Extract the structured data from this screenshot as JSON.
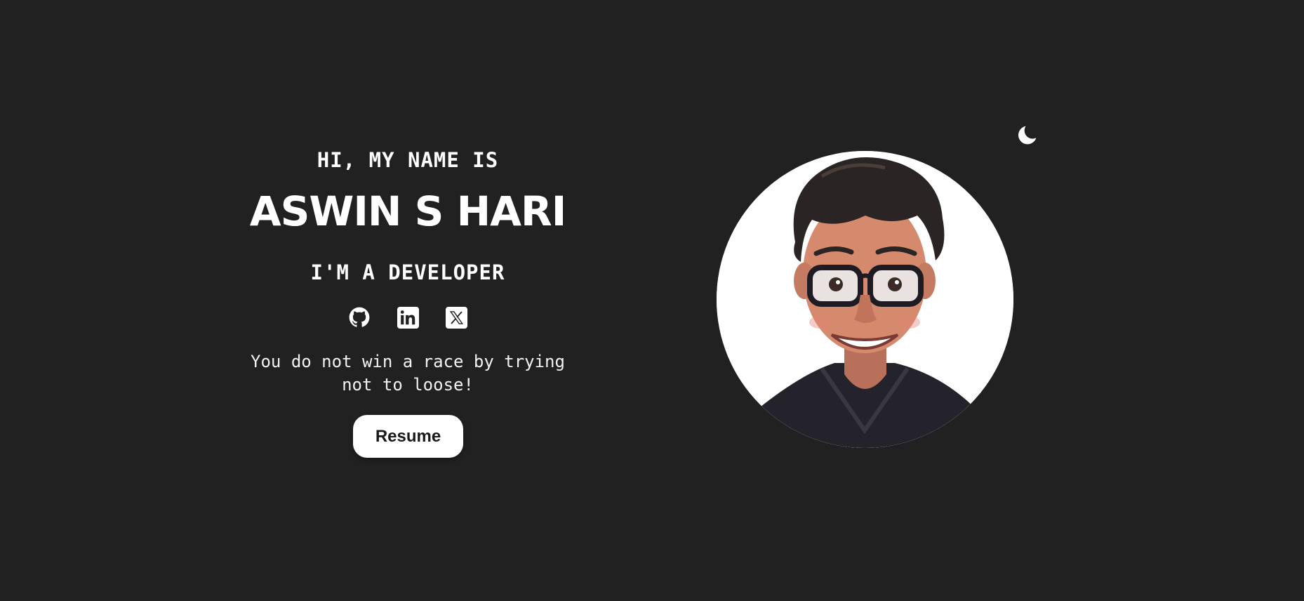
{
  "hero": {
    "greeting": "HI, MY NAME IS",
    "name": "ASWIN S HARI",
    "role": "I'M A DEVELOPER",
    "quote": "You do not win a race by trying not to loose!",
    "resume_label": "Resume"
  },
  "socials": [
    {
      "icon": "github-icon"
    },
    {
      "icon": "linkedin-icon"
    },
    {
      "icon": "x-twitter-icon"
    }
  ],
  "theme_toggle": {
    "icon": "moon-icon"
  },
  "avatar": {
    "icon": "cartoon-developer-avatar"
  },
  "colors": {
    "background": "#212121",
    "text": "#ffffff",
    "button_bg": "#ffffff",
    "button_text": "#1a1a1a"
  }
}
